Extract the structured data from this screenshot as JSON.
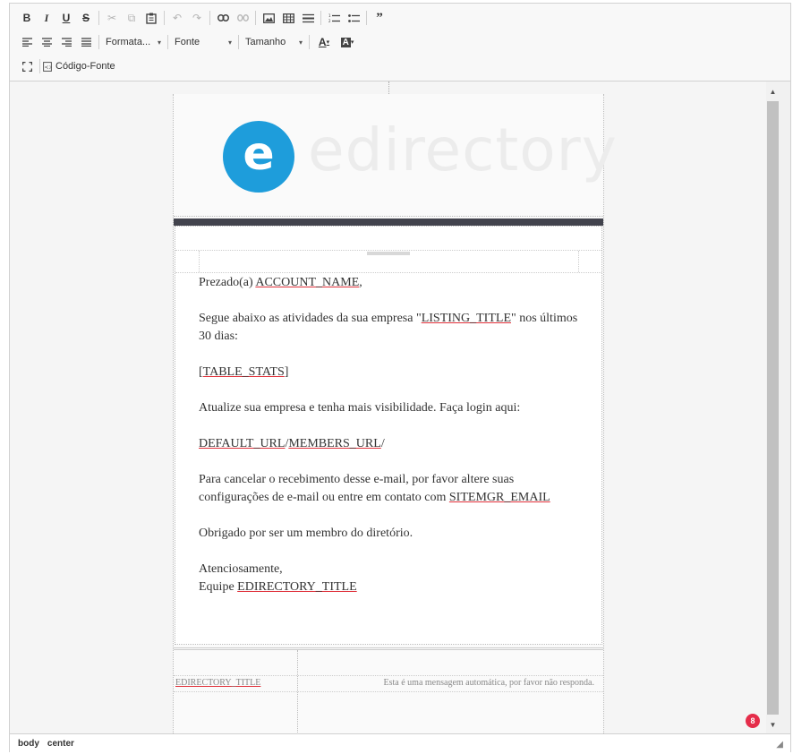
{
  "toolbar": {
    "row1": [
      {
        "name": "bold-button",
        "glyph": "B",
        "style": "bold"
      },
      {
        "name": "italic-button",
        "glyph": "I",
        "style": "italic"
      },
      {
        "name": "underline-button",
        "glyph": "U",
        "style": "underline"
      },
      {
        "name": "strikethrough-button",
        "glyph": "S",
        "style": "strike"
      }
    ],
    "format_label": "Formata...",
    "font_label": "Fonte",
    "size_label": "Tamanho",
    "source_label": "Código-Fonte"
  },
  "logo": {
    "letter": "e",
    "word": "edirectory",
    "accent_color": "#1e9ddb"
  },
  "email": {
    "greeting_prefix": "Prezado(a) ",
    "greeting_var": "ACCOUNT_NAME",
    "greeting_suffix": ",",
    "activity_prefix": "Segue abaixo as atividades da sua empresa \"",
    "activity_var": "LISTING_TITLE",
    "activity_suffix": "\" nos últimos 30 dias:",
    "stats_open": "[",
    "stats_var": "TABLE_STATS",
    "stats_close": "]",
    "update_text": "Atualize sua empresa e tenha mais visibilidade. Faça login aqui:",
    "url_var1": "DEFAULT_URL",
    "url_sep": "/",
    "url_var2": "MEMBERS_URL",
    "url_end": "/",
    "cancel_text": "Para cancelar o recebimento desse e-mail, por favor altere suas configurações de e-mail ou entre em contato com ",
    "cancel_var": "SITEMGR_EMAIL",
    "thanks_text": "Obrigado por ser um membro do diretório.",
    "regards_text": "Atenciosamente,",
    "team_prefix": "Equipe ",
    "team_var": "EDIRECTORY_TITLE"
  },
  "footer": {
    "left": "EDIRECTORY_TITLE",
    "right": "Esta é uma mensagem automática, por favor não responda."
  },
  "statusbar": {
    "path1": "body",
    "path2": "center"
  },
  "badge_count": "8"
}
